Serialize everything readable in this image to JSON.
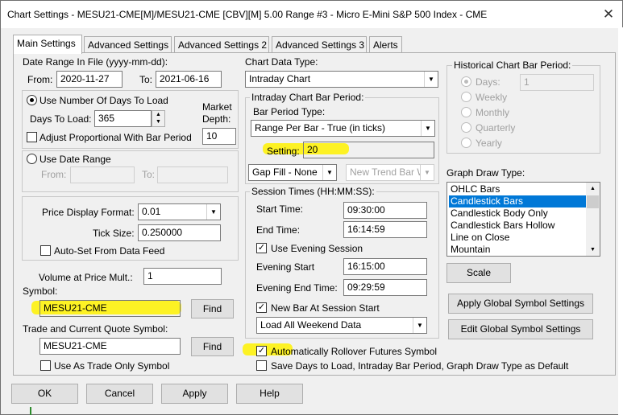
{
  "window": {
    "title": "Chart Settings - MESU21-CME[M]/MESU21-CME [CBV][M]  5.00 Range  #3 - Micro E-Mini S&P 500 Index - CME",
    "close_glyph": "✕"
  },
  "tabs": [
    {
      "label": "Main Settings"
    },
    {
      "label": "Advanced Settings"
    },
    {
      "label": "Advanced Settings 2"
    },
    {
      "label": "Advanced Settings 3"
    },
    {
      "label": "Alerts"
    }
  ],
  "date_range": {
    "title": "Date Range In File (yyyy-mm-dd):",
    "from_label": "From:",
    "from_value": "2020-11-27",
    "to_label": "To:",
    "to_value": "2021-06-16"
  },
  "days_group": {
    "use_days_label": "Use Number Of Days To Load",
    "days_to_load_label": "Days To Load:",
    "days_to_load_value": "365",
    "market_label_1": "Market",
    "market_label_2": "Depth:",
    "market_depth_value": "10",
    "adjust_label": "Adjust Proportional With Bar Period"
  },
  "date_range_group": {
    "use_date_range_label": "Use Date Range",
    "from_label": "From:",
    "to_label": "To:"
  },
  "price_group": {
    "price_format_label": "Price Display Format:",
    "price_format_value": "0.01",
    "tick_size_label": "Tick Size:",
    "tick_size_value": "0.250000",
    "auto_set_label": "Auto-Set From Data Feed"
  },
  "symbol": {
    "vap_label": "Volume at Price Mult.:",
    "vap_value": "1",
    "symbol_label": "Symbol:",
    "symbol_value": "MESU21-CME",
    "find_label": "Find",
    "trade_label": "Trade and Current Quote Symbol:",
    "trade_value": "MESU21-CME",
    "find2_label": "Find",
    "trade_only_label": "Use As Trade Only Symbol"
  },
  "chart_data_type": {
    "label": "Chart Data Type:",
    "value": "Intraday Chart"
  },
  "intraday_group": {
    "title": "Intraday Chart Bar Period:",
    "bar_type_label": "Bar Period Type:",
    "bar_type_value": "Range Per Bar - True (in ticks)",
    "setting_label": "Setting:",
    "setting_value": "20",
    "gap_fill_value": "Gap Fill - None",
    "new_trend_value": "New Trend Bar W"
  },
  "session_group": {
    "title": "Session Times (HH:MM:SS):",
    "start_label": "Start Time:",
    "start_value": "09:30:00",
    "end_label": "End Time:",
    "end_value": "16:14:59",
    "use_evening_label": "Use Evening Session",
    "evening_start_label": "Evening Start",
    "evening_start_value": "16:15:00",
    "evening_end_label": "Evening End Time:",
    "evening_end_value": "09:29:59",
    "new_bar_label": "New Bar At Session Start",
    "weekend_value": "Load All Weekend Data"
  },
  "historical_group": {
    "title": "Historical Chart Bar Period:",
    "days_label": "Days:",
    "days_value": "1",
    "weekly": "Weekly",
    "monthly": "Monthly",
    "quarterly": "Quarterly",
    "yearly": "Yearly"
  },
  "graph_draw": {
    "label": "Graph Draw Type:",
    "items": [
      "OHLC Bars",
      "Candlestick Bars",
      "Candlestick Body Only",
      "Candlestick Bars Hollow",
      "Line on Close",
      "Mountain"
    ],
    "selected_index": 1
  },
  "right_buttons": {
    "scale": "Scale",
    "apply_global": "Apply Global Symbol Settings",
    "edit_global": "Edit Global Symbol Settings"
  },
  "bottom_checks": {
    "auto_rollover": "Automatically Rollover Futures Symbol",
    "save_days": "Save Days to Load, Intraday Bar Period, Graph Draw Type as Default"
  },
  "footer": {
    "ok": "OK",
    "cancel": "Cancel",
    "apply": "Apply",
    "help": "Help"
  },
  "glyphs": {
    "check": "✓",
    "arrow_down": "▼",
    "arrow_up": "▲"
  },
  "colors": {
    "highlight": "#fff200",
    "selection": "#0078d7"
  }
}
